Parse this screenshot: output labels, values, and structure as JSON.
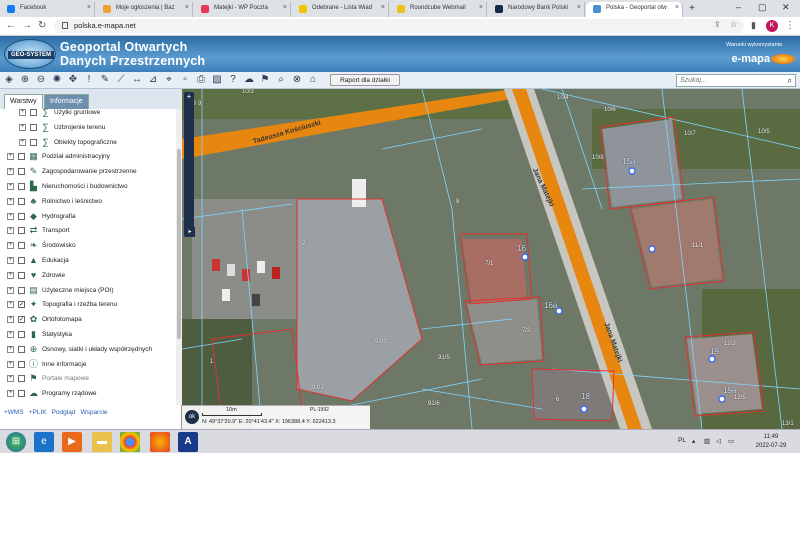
{
  "browser": {
    "tabs": [
      {
        "label": "Facebook",
        "color": "#1877f2"
      },
      {
        "label": "Moje ogłoszenia | Baz",
        "color": "#f0a030"
      },
      {
        "label": "Matejki - WP Poczta",
        "color": "#e8384f"
      },
      {
        "label": "Odebrane - Lista Wiad",
        "color": "#f5c400"
      },
      {
        "label": "Roundcube Webmail",
        "color": "#f0c020"
      },
      {
        "label": "Narodowy Bank Polski",
        "color": "#1b2a4a"
      },
      {
        "label": "Polska - Geoportal otw",
        "color": "#4a8fd0"
      }
    ],
    "url": "polska.e-mapa.net",
    "avatar_letter": "K"
  },
  "app": {
    "logo_text": "GEO-SYSTEM",
    "title_line1": "Geoportal Otwartych",
    "title_line2": "Danych Przestrzennych",
    "sponsor_label": "Warunki wykorzystania",
    "brand": "e-mapa",
    "toolbar": {
      "report_button": "Raport dla działki",
      "search_placeholder": "Szukaj..."
    }
  },
  "panel": {
    "tabs": {
      "layers": "Warstwy",
      "info": "Informacje"
    },
    "layers": [
      {
        "label": "Użytki gruntowe",
        "checked": false,
        "sub": true,
        "icon": "∑"
      },
      {
        "label": "Uzbrojenie terenu",
        "checked": false,
        "sub": true,
        "icon": "∑"
      },
      {
        "label": "Obiekty topograficzne",
        "checked": false,
        "sub": true,
        "icon": "∑"
      },
      {
        "label": "Podział administracyjny",
        "checked": false,
        "sub": false,
        "icon": "▦"
      },
      {
        "label": "Zagospodarowanie przestrzenne",
        "checked": false,
        "sub": false,
        "icon": "✎"
      },
      {
        "label": "Nieruchomości i budownictwo",
        "checked": false,
        "sub": false,
        "icon": "▙"
      },
      {
        "label": "Rolnictwo i leśnictwo",
        "checked": false,
        "sub": false,
        "icon": "♣"
      },
      {
        "label": "Hydrografia",
        "checked": false,
        "sub": false,
        "icon": "◆"
      },
      {
        "label": "Transport",
        "checked": false,
        "sub": false,
        "icon": "⇄"
      },
      {
        "label": "Środowisko",
        "checked": false,
        "sub": false,
        "icon": "❧"
      },
      {
        "label": "Edukacja",
        "checked": false,
        "sub": false,
        "icon": "▲"
      },
      {
        "label": "Zdrowie",
        "checked": false,
        "sub": false,
        "icon": "♥"
      },
      {
        "label": "Użyteczne miejsca (POI)",
        "checked": false,
        "sub": false,
        "icon": "▤"
      },
      {
        "label": "Topografia i rzeźba terenu",
        "checked": true,
        "sub": false,
        "icon": "✦"
      },
      {
        "label": "Ortofotomapa",
        "checked": true,
        "sub": false,
        "icon": "✿"
      },
      {
        "label": "Statystyka",
        "checked": false,
        "sub": false,
        "icon": "▮"
      },
      {
        "label": "Osnowy, siatki i układy współrzędnych",
        "checked": false,
        "sub": false,
        "icon": "⊕"
      },
      {
        "label": "Inne informacje",
        "checked": false,
        "sub": false,
        "icon": "ⓘ"
      },
      {
        "label": "Portale mapowe",
        "checked": false,
        "sub": false,
        "icon": "⚑",
        "dim": true
      },
      {
        "label": "Programy rządowe",
        "checked": false,
        "sub": false,
        "icon": "☁"
      }
    ],
    "links": [
      "+WMS",
      "+PLIK",
      "Podgląd",
      "Wsparcie"
    ]
  },
  "map": {
    "streets": [
      "Tadeusza Kościuszki",
      "Jana Matejki",
      "Jana Matejki"
    ],
    "parcels": [
      "10/8",
      "10/4",
      "10/6",
      "10/7",
      "10/5",
      "10/9",
      "10/3",
      "8",
      "2",
      "7/1",
      "7/2",
      "16",
      "16a",
      "15a",
      "11/1",
      "91/3",
      "91/1",
      "91/5",
      "91/6",
      "1",
      "6",
      "18",
      "19",
      "19a",
      "12/3",
      "12/5",
      "13/1",
      "9"
    ],
    "scale_label": "10m",
    "crs": "PL-1992",
    "coords": "N: 49°37'20.9\"   E: 20°41'43.4\"   X: 196388.4   Y: 622413.3",
    "ok_label": "ok"
  },
  "taskbar": {
    "lang": "PL",
    "time": "11:49",
    "date": "2022-07-29"
  }
}
